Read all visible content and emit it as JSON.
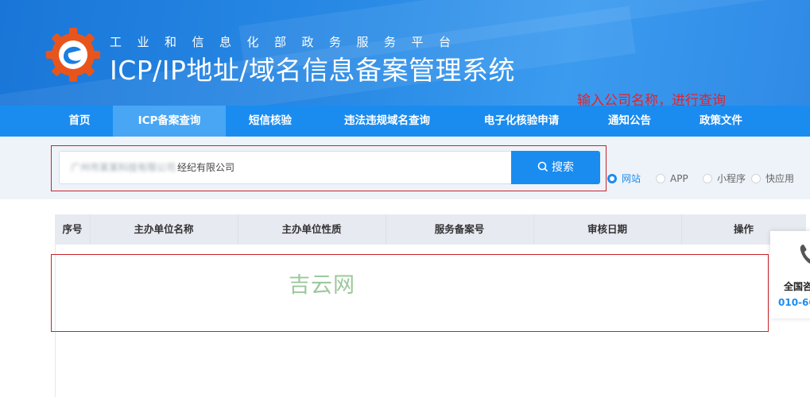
{
  "header": {
    "subtitle": "工业和信息化部政务服务平台",
    "title": "ICP/IP地址/域名信息备案管理系统"
  },
  "nav": {
    "items": [
      {
        "label": "首页",
        "active": false
      },
      {
        "label": "ICP备案查询",
        "active": true
      },
      {
        "label": "短信核验",
        "active": false
      },
      {
        "label": "违法违规域名查询",
        "active": false
      },
      {
        "label": "电子化核验申请",
        "active": false
      },
      {
        "label": "通知公告",
        "active": false
      },
      {
        "label": "政策文件",
        "active": false
      }
    ]
  },
  "annotation": {
    "text": "输入公司名称，进行查询",
    "color": "#e8202a"
  },
  "search": {
    "value_blurred": "广州市某某科技有限公司",
    "value_visible": "经纪有限公司",
    "button_label": "搜索",
    "button_icon": "search-icon"
  },
  "filters": [
    {
      "label": "网站",
      "checked": true
    },
    {
      "label": "APP",
      "checked": false
    },
    {
      "label": "小程序",
      "checked": false
    },
    {
      "label": "快应用",
      "checked": false
    }
  ],
  "table": {
    "columns": [
      "序号",
      "主办单位名称",
      "主办单位性质",
      "服务备案号",
      "审核日期",
      "操作"
    ],
    "rows": []
  },
  "watermark": "吉云网",
  "side_panel": {
    "icon": "phone-icon",
    "label": "全国咨",
    "phone": "010-66"
  },
  "colors": {
    "header_blue": "#1976d8",
    "nav_blue": "#1a8cf0",
    "nav_active": "#48a6f5",
    "highlight_red": "#c9242c"
  }
}
